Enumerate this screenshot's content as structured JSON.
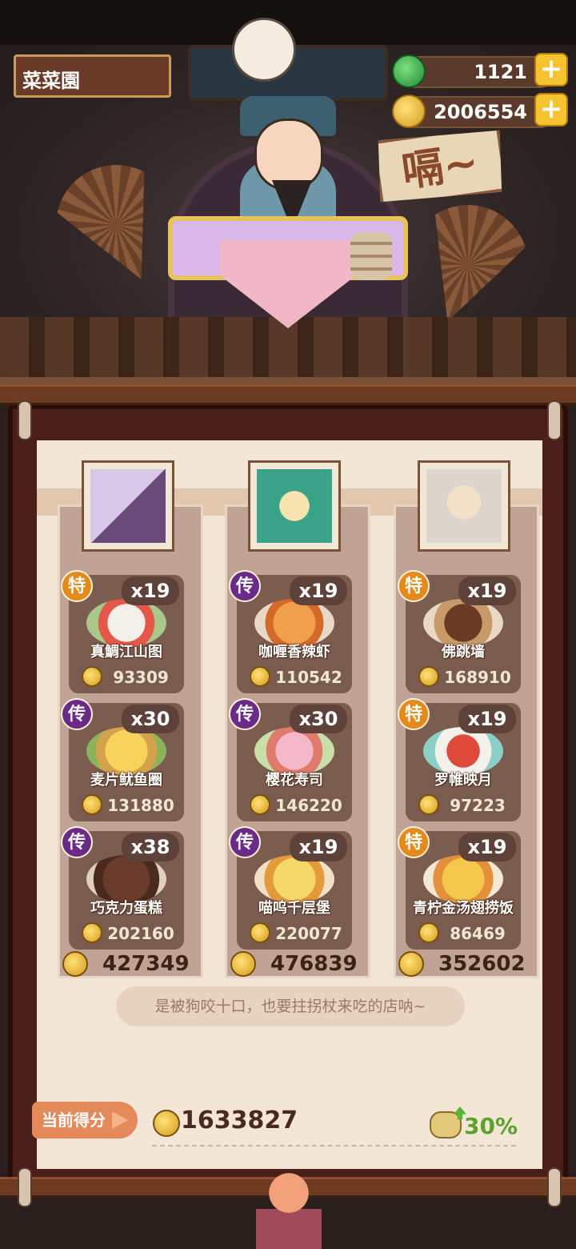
{
  "hud": {
    "player_name": "菜菜園",
    "jade": "1121",
    "coins": "2006554",
    "speech": "嗝~"
  },
  "colors": {
    "tag_special": "#e38a1a",
    "tag_legend": "#6a2a88",
    "bonus_green": "#5aa22a"
  },
  "columns": [
    {
      "dishes": [
        {
          "tag": "特",
          "tag_type": "special",
          "count": "x19",
          "name": "真鯛江山图",
          "value": "93309"
        },
        {
          "tag": "传",
          "tag_type": "legend",
          "count": "x30",
          "name": "麦片鱿鱼圈",
          "value": "131880"
        },
        {
          "tag": "传",
          "tag_type": "legend",
          "count": "x38",
          "name": "巧克力蛋糕",
          "value": "202160"
        }
      ],
      "total": "427349"
    },
    {
      "dishes": [
        {
          "tag": "传",
          "tag_type": "legend",
          "count": "x19",
          "name": "咖喱香辣虾",
          "value": "110542"
        },
        {
          "tag": "传",
          "tag_type": "legend",
          "count": "x30",
          "name": "樱花寿司",
          "value": "146220"
        },
        {
          "tag": "传",
          "tag_type": "legend",
          "count": "x19",
          "name": "喵呜千层堡",
          "value": "220077"
        }
      ],
      "total": "476839"
    },
    {
      "dishes": [
        {
          "tag": "特",
          "tag_type": "special",
          "count": "x19",
          "name": "佛跳墙",
          "value": "168910"
        },
        {
          "tag": "特",
          "tag_type": "special",
          "count": "x19",
          "name": "罗帷映月",
          "value": "97223"
        },
        {
          "tag": "特",
          "tag_type": "special",
          "count": "x19",
          "name": "青柠金汤翅捞饭",
          "value": "86469"
        }
      ],
      "total": "352602"
    }
  ],
  "slogan": "是被狗咬十口，也要拄拐杖来吃的店呐~",
  "score": {
    "label": "当前得分",
    "value": "1633827",
    "bonus": "30%"
  }
}
